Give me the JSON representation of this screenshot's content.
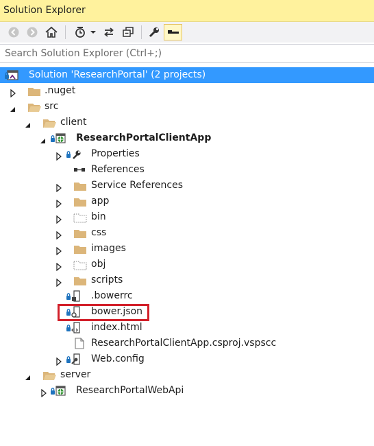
{
  "window": {
    "title": "Solution Explorer"
  },
  "toolbar": {
    "buttons": [
      "back-icon",
      "forward-icon",
      "home-icon",
      "pending-changes-icon",
      "dropdown-icon",
      "sync-icon",
      "collapse-all-icon",
      "properties-icon",
      "preview-icon"
    ]
  },
  "search": {
    "placeholder": "Search Solution Explorer (Ctrl+;)",
    "value": ""
  },
  "tree": {
    "solution": "Solution 'ResearchPortal' (2 projects)",
    "nuget": ".nuget",
    "src": "src",
    "client": "client",
    "client_project": "ResearchPortalClientApp",
    "properties": "Properties",
    "references": "References",
    "service_references": "Service References",
    "app": "app",
    "bin": "bin",
    "css": "css",
    "images": "images",
    "obj": "obj",
    "scripts": "scripts",
    "bowerrc": ".bowerrc",
    "bower_json": "bower.json",
    "index_html": "index.html",
    "vspscc": "ResearchPortalClientApp.csproj.vspscc",
    "web_config": "Web.config",
    "server": "server",
    "server_project": "ResearchPortalWebApi"
  },
  "colors": {
    "title_bar": "#fff29d",
    "selection": "#3399ff",
    "highlight_box": "#d2202a",
    "folder": "#dcb67a",
    "lock": "#1e73be"
  }
}
